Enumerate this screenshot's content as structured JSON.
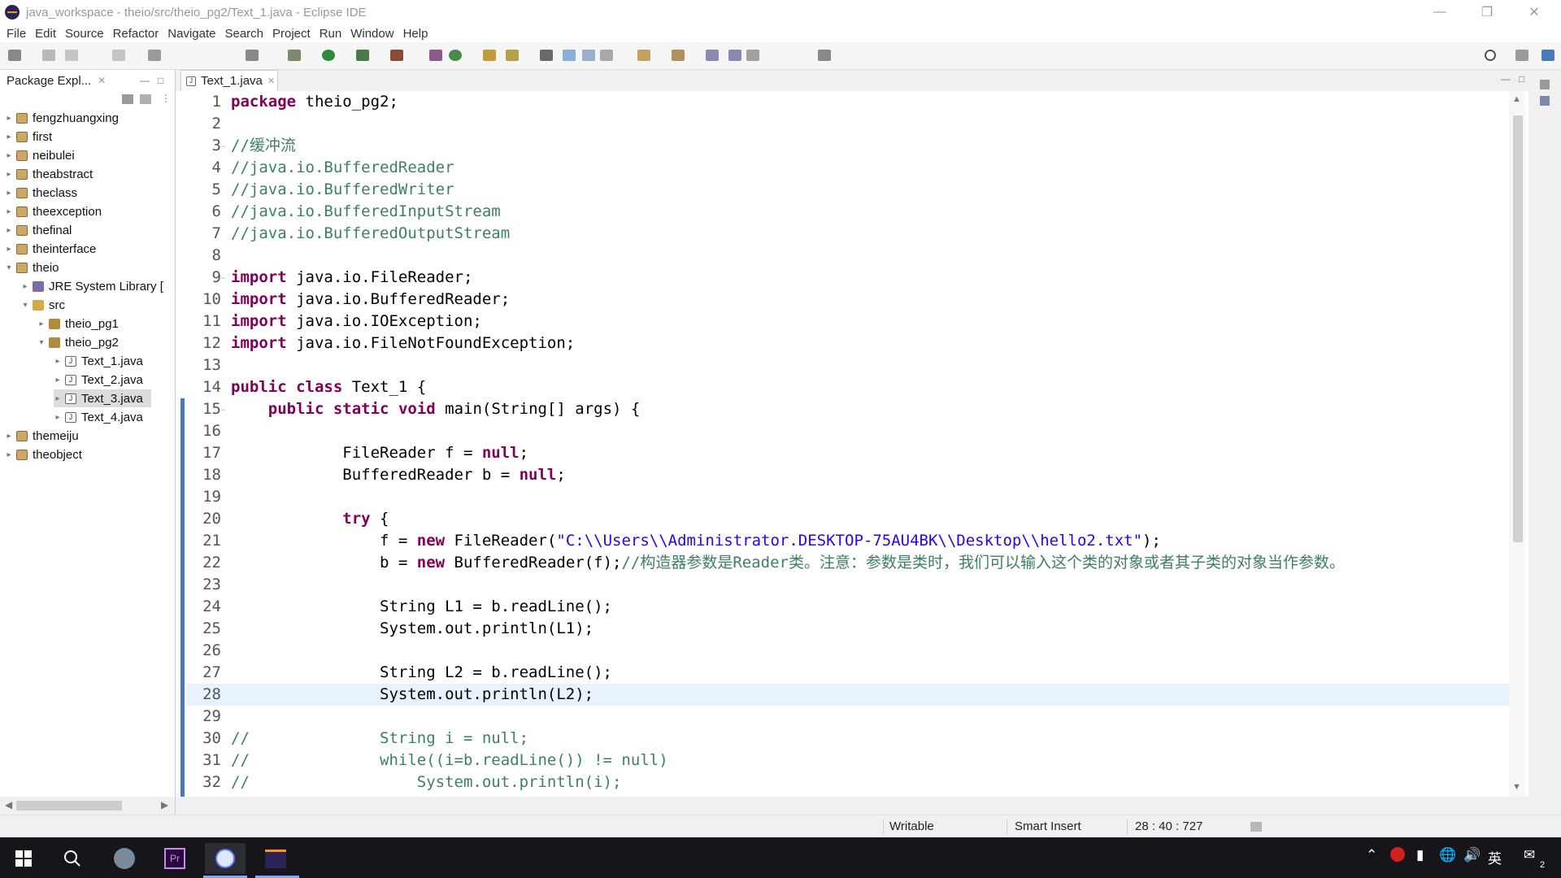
{
  "window": {
    "title": "java_workspace - theio/src/theio_pg2/Text_1.java - Eclipse IDE"
  },
  "menu": [
    "File",
    "Edit",
    "Source",
    "Refactor",
    "Navigate",
    "Search",
    "Project",
    "Run",
    "Window",
    "Help"
  ],
  "package_explorer": {
    "title": "Package Expl...",
    "items": [
      {
        "label": "fengzhuangxing"
      },
      {
        "label": "first"
      },
      {
        "label": "neibulei"
      },
      {
        "label": "theabstract"
      },
      {
        "label": "theclass"
      },
      {
        "label": "theexception"
      },
      {
        "label": "thefinal"
      },
      {
        "label": "theinterface"
      },
      {
        "label": "theio"
      },
      {
        "label": "JRE System Library ["
      },
      {
        "label": "src"
      },
      {
        "label": "theio_pg1"
      },
      {
        "label": "theio_pg2"
      },
      {
        "label": "Text_1.java"
      },
      {
        "label": "Text_2.java"
      },
      {
        "label": "Text_3.java"
      },
      {
        "label": "Text_4.java"
      },
      {
        "label": "themeiju"
      },
      {
        "label": "theobject"
      }
    ]
  },
  "editor": {
    "tab_label": "Text_1.java",
    "lines": [
      {
        "n": "1",
        "text": "package theio_pg2;"
      },
      {
        "n": "2",
        "text": ""
      },
      {
        "n": "3",
        "text": "//缓冲流"
      },
      {
        "n": "4",
        "text": "//java.io.BufferedReader"
      },
      {
        "n": "5",
        "text": "//java.io.BufferedWriter"
      },
      {
        "n": "6",
        "text": "//java.io.BufferedInputStream"
      },
      {
        "n": "7",
        "text": "//java.io.BufferedOutputStream"
      },
      {
        "n": "8",
        "text": ""
      },
      {
        "n": "9",
        "text": "import java.io.FileReader;"
      },
      {
        "n": "10",
        "text": "import java.io.BufferedReader;"
      },
      {
        "n": "11",
        "text": "import java.io.IOException;"
      },
      {
        "n": "12",
        "text": "import java.io.FileNotFoundException;"
      },
      {
        "n": "13",
        "text": ""
      },
      {
        "n": "14",
        "text": "public class Text_1 {"
      },
      {
        "n": "15",
        "text": "    public static void main(String[] args) {"
      },
      {
        "n": "16",
        "text": ""
      },
      {
        "n": "17",
        "text": "            FileReader f = null;"
      },
      {
        "n": "18",
        "text": "            BufferedReader b = null;"
      },
      {
        "n": "19",
        "text": ""
      },
      {
        "n": "20",
        "text": "            try {"
      },
      {
        "n": "21",
        "text": "                f = new FileReader(\"C:\\\\Users\\\\Administrator.DESKTOP-75AU4BK\\\\Desktop\\\\hello2.txt\");"
      },
      {
        "n": "22",
        "text": "                b = new BufferedReader(f);//构造器参数是Reader类。注意：参数是类时，我们可以输入这个类的对象或者其子类的对象当作参数。"
      },
      {
        "n": "23",
        "text": ""
      },
      {
        "n": "24",
        "text": "                String L1 = b.readLine();"
      },
      {
        "n": "25",
        "text": "                System.out.println(L1);"
      },
      {
        "n": "26",
        "text": ""
      },
      {
        "n": "27",
        "text": "                String L2 = b.readLine();"
      },
      {
        "n": "28",
        "text": "                System.out.println(L2);"
      },
      {
        "n": "29",
        "text": ""
      },
      {
        "n": "30",
        "text": "//              String i = null;"
      },
      {
        "n": "31",
        "text": "//              while((i=b.readLine()) != null)"
      },
      {
        "n": "32",
        "text": "//                  System.out.println(i);"
      }
    ]
  },
  "status": {
    "writable": "Writable",
    "insert_mode": "Smart Insert",
    "position": "28 : 40 : 727"
  },
  "tray": {
    "ime": "英",
    "notifications": "2"
  },
  "colors": {
    "keyword": "#7f0055",
    "comment": "#3f7f5f",
    "string": "#2a00ff",
    "current_line": "#e8f2fe",
    "taskbar": "#15151a"
  }
}
